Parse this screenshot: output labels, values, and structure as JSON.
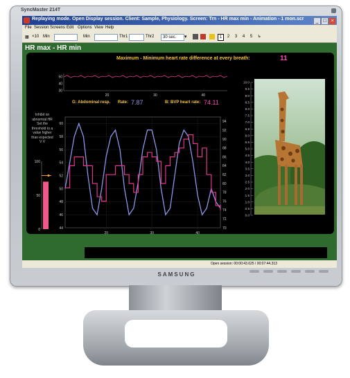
{
  "monitor": {
    "model": "SyncMaster 214T",
    "brand": "SAMSUNG"
  },
  "window": {
    "title": "Replaying mode. Open Display session. Client: Sample, Physiology. Screen: Trn - HR max min - Animation - 1 mon.scr",
    "buttons": [
      "_",
      "□",
      "×"
    ]
  },
  "menu": [
    "File",
    "Session",
    "Screens",
    "Edit",
    "Options",
    "View",
    "Help"
  ],
  "toolbar": {
    "x10": "×10",
    "min1": "Min",
    "min2": "Min",
    "thr1": "Thr1",
    "thr2": "Thr2",
    "interval": "30 sec.",
    "pages": [
      "1",
      "2",
      "3",
      "4",
      "5"
    ]
  },
  "screen": {
    "title": "HR max - HR min",
    "max_min_label": "Maximum - Minimum heart rate difference at every breath:",
    "max_min_value": "11",
    "abdominal_label": "G: Abdominal resp.",
    "rate_label": "Rate:",
    "rate_value": "7.87",
    "bvp_label": "B: BVP heart rate:",
    "bvp_value": "74.11",
    "instruction": [
      "Inhibit on",
      "abnormal HR",
      "Set the",
      "threshold to a",
      "value higher",
      "than expected",
      "V    V"
    ],
    "status": "Open session: 00:00:43.625 / 00:07:44.313"
  },
  "colors": {
    "screen_green": "#2f6b2f",
    "panel_black": "#000000",
    "gold_text": "#f2c43b",
    "pink_value": "#ff46b8",
    "resp_line": "#8f95e8",
    "hr_line": "#e0388a",
    "bar_fill": "#f0588c"
  },
  "chart_data": [
    {
      "type": "line",
      "title": "",
      "series": [
        {
          "values": [
            50,
            52,
            49,
            51,
            50,
            52,
            49,
            51,
            50,
            52,
            49,
            51,
            50,
            52,
            49,
            51,
            50,
            52,
            49,
            51,
            50,
            52,
            49,
            51,
            50,
            52,
            49,
            51,
            50,
            52,
            49,
            51,
            50,
            52,
            49,
            51,
            50,
            52,
            49,
            51,
            50,
            52,
            49,
            51,
            50,
            52,
            49,
            51
          ]
        }
      ],
      "x": {
        "ticks": [
          20,
          30,
          40
        ],
        "range": [
          11,
          45
        ]
      },
      "y": {
        "ticks": [
          30,
          40,
          50
        ],
        "range": [
          30,
          55
        ]
      }
    },
    {
      "type": "line",
      "series": [
        {
          "name": "Abdominal resp.",
          "axis": "left",
          "x": [
            11,
            12,
            13,
            14,
            15,
            16,
            17,
            18,
            19,
            20,
            21,
            22,
            23,
            24,
            25,
            26,
            27,
            28,
            29,
            30,
            31,
            32,
            33,
            34,
            35,
            36,
            37,
            38,
            39,
            40,
            41,
            42,
            43,
            44,
            45
          ],
          "values": [
            50,
            54,
            58,
            60,
            58,
            52,
            47,
            46,
            50,
            55,
            58,
            59,
            56,
            50,
            46,
            47,
            51,
            56,
            59,
            59,
            56,
            50,
            46,
            47,
            52,
            57,
            59,
            58,
            54,
            49,
            46,
            47,
            50,
            48,
            47
          ]
        },
        {
          "name": "BVP heart rate",
          "axis": "right",
          "x": [
            11,
            12,
            13,
            14,
            15,
            16,
            17,
            18,
            19,
            20,
            21,
            22,
            23,
            24,
            25,
            26,
            27,
            28,
            29,
            30,
            31,
            32,
            33,
            34,
            35,
            36,
            37,
            38,
            39,
            40,
            41,
            42,
            43,
            44,
            45
          ],
          "values": [
            79,
            84,
            86,
            86,
            84,
            84,
            80,
            77,
            76,
            82,
            82,
            84,
            84,
            82,
            80,
            78,
            82,
            86,
            87,
            86,
            85,
            80,
            84,
            86,
            87,
            88,
            90,
            91,
            89,
            86,
            88,
            82,
            78,
            75,
            74
          ]
        }
      ],
      "x": {
        "ticks": [
          20,
          30,
          40
        ],
        "range": [
          11,
          45
        ]
      },
      "y_left": {
        "ticks": [
          44,
          46,
          48,
          50,
          52,
          54,
          56,
          58,
          60
        ],
        "range": [
          44,
          61
        ]
      },
      "y_right": {
        "ticks": [
          70,
          72,
          74,
          76,
          78,
          80,
          82,
          84,
          86,
          88,
          90,
          92,
          94
        ],
        "range": [
          70,
          95
        ]
      }
    },
    {
      "type": "bar",
      "title": "",
      "values": [
        70
      ],
      "threshold": 79,
      "y": {
        "ticks": [
          0,
          50,
          100
        ],
        "range": [
          0,
          100
        ]
      }
    },
    {
      "type": "axis",
      "ticks": [
        "10.0",
        "9.5",
        "9.0",
        "8.5",
        "8.0",
        "7.5",
        "7.0",
        "6.5",
        "6.0",
        "5.5",
        "5.0",
        "4.5",
        "4.0",
        "3.5",
        "3.0",
        "2.5",
        "2.0",
        "1.5",
        "1.0",
        "0.5",
        "0.0"
      ],
      "range": [
        0,
        10
      ]
    }
  ]
}
